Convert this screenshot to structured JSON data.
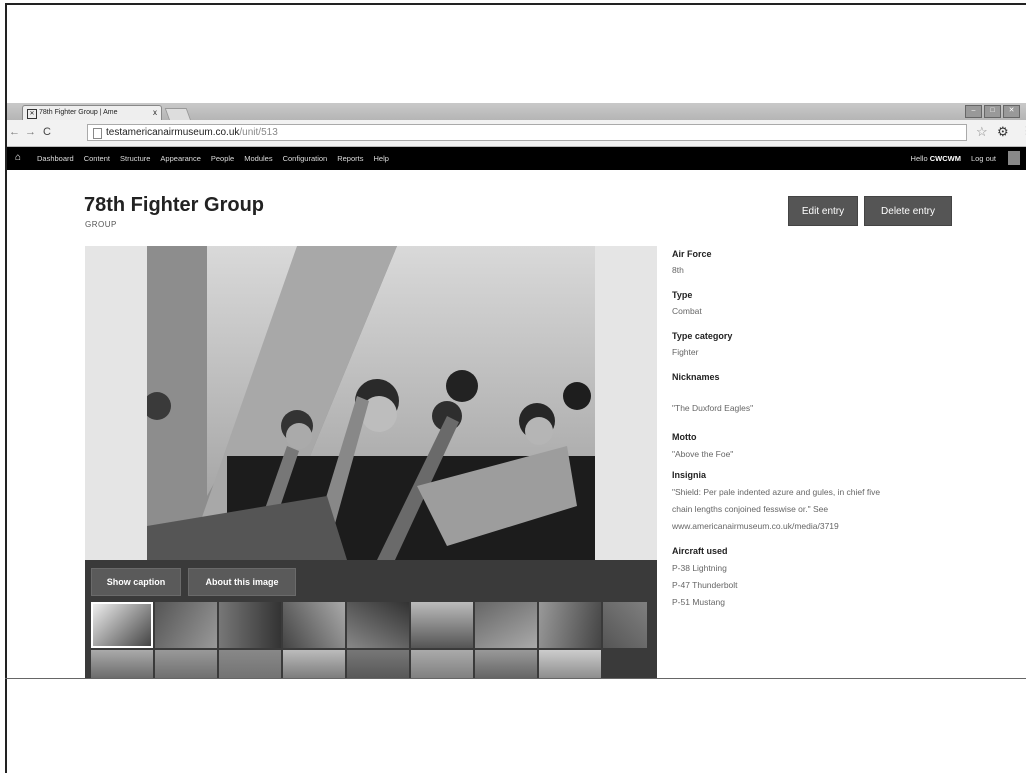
{
  "browser": {
    "tab_title": "78th Fighter Group | Ame",
    "tab_close": "x",
    "url_host": "testamericanairmuseum.co.uk",
    "url_path": "/unit/513"
  },
  "admin_toolbar": {
    "items": [
      "Dashboard",
      "Content",
      "Structure",
      "Appearance",
      "People",
      "Modules",
      "Configuration",
      "Reports",
      "Help"
    ],
    "greeting_prefix": "Hello ",
    "username": "CWCWM",
    "logout": "Log out"
  },
  "page": {
    "title": "78th Fighter Group",
    "subtitle": "GROUP",
    "edit_label": "Edit entry",
    "delete_label": "Delete entry"
  },
  "gallery": {
    "show_caption_label": "Show caption",
    "about_image_label": "About this image"
  },
  "details": {
    "air_force_label": "Air Force",
    "air_force_value": "8th",
    "type_label": "Type",
    "type_value": "Combat",
    "type_category_label": "Type category",
    "type_category_value": "Fighter",
    "nicknames_label": "Nicknames",
    "nicknames_value": "\"The Duxford Eagles\"",
    "motto_label": "Motto",
    "motto_value": "\"Above the Foe\"",
    "insignia_label": "Insignia",
    "insignia_line1": "\"Shield: Per pale indented azure and gules, in chief five",
    "insignia_line2": "chain lengths conjoined fesswise or.\" See",
    "insignia_line3": "www.americanairmuseum.co.uk/media/3719",
    "aircraft_label": "Aircraft used",
    "aircraft": [
      "P-38 Lightning",
      "P-47 Thunderbolt",
      "P-51 Mustang"
    ]
  }
}
